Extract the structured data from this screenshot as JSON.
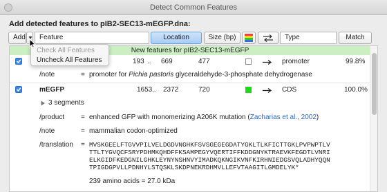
{
  "window": {
    "title": "Detect Common Features"
  },
  "heading": "Add detected features to pIB2-SEC13-mEGFP.dna:",
  "toolbar": {
    "add_label": "Add",
    "feature_col": "Feature",
    "location_col": "Location",
    "size_col": "Size (bp)",
    "type_col": "Type",
    "match_col": "Match"
  },
  "add_menu": {
    "items": [
      {
        "label": "Check All Features",
        "enabled": false
      },
      {
        "label": "Uncheck All Features",
        "enabled": true
      }
    ]
  },
  "banner": "New features for pIB2-SEC13-mEGFP",
  "features": [
    {
      "checked": true,
      "name": "",
      "start": "193",
      "end": "669",
      "size": "477",
      "color": "none",
      "type": "promoter",
      "match": "99.8%",
      "note_key": "/note",
      "note_prefix": "promoter for ",
      "note_italic": "Pichia pastoris",
      "note_suffix": " glyceraldehyde-3-phosphate dehydrogenase"
    },
    {
      "checked": true,
      "name": "mEGFP",
      "start": "1653",
      "end": "2372",
      "size": "720",
      "color": "#1bd91b",
      "type": "CDS",
      "match": "100.0%",
      "segments": "3 segments",
      "product_key": "/product",
      "product_value": "enhanced GFP with monomerizing A206K mutation (",
      "product_link": "Zacharias et al., 2002",
      "product_close": ")",
      "note_key": "/note",
      "note_value": "mammalian codon-optimized",
      "translation_key": "/translation",
      "translation_lines": [
        "MVSKGEELFTGVVPILVELDGDVNGHKFSVSGEGEGDATYGKLTLKFICTTGKLPVPWPTLV",
        "TTLTYGVQCFSRYPDHMKQHDFFKSAMPEGYVQERTIFFKDDGNYKTRAEVKFEGDTLVNRI",
        "ELKGIDFKEDGNILGHKLEYNYNSHNVYIMADKQKNGIKVNFKIRHNIEDGSVQLADHYQQN",
        "TPIGDGPVLLPDNHYLSTQSKLSKDPNEKRDHMVLLEFVTAAGITLGMDELYK*"
      ],
      "aa_summary": "239 amino acids  =  27.0 kDa"
    }
  ],
  "colors": {
    "accent": "#3b86e6",
    "banner": "#cbeec3",
    "swatch_green": "#1bd91b",
    "link": "#2a66c9"
  }
}
